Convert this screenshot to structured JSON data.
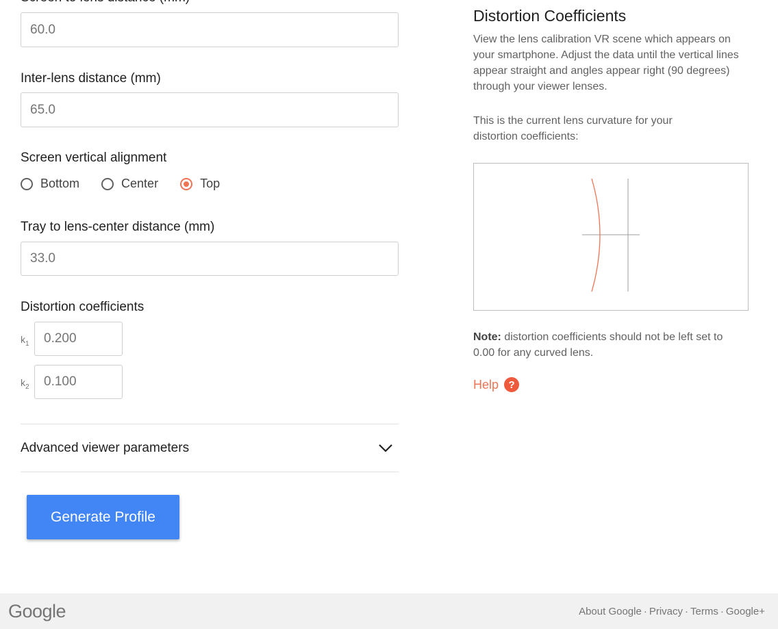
{
  "form": {
    "screen_to_lens": {
      "label": "Screen to lens distance (mm)",
      "value": "60.0"
    },
    "inter_lens": {
      "label": "Inter-lens distance (mm)",
      "value": "65.0"
    },
    "vertical_alignment": {
      "label": "Screen vertical alignment",
      "options": [
        "Bottom",
        "Center",
        "Top"
      ],
      "selected": "Top"
    },
    "tray_to_lens": {
      "label": "Tray to lens-center distance (mm)",
      "value": "33.0"
    },
    "distortion": {
      "label": "Distortion coefficients",
      "k1_label": "k",
      "k1_sub": "1",
      "k1_value": "0.200",
      "k2_label": "k",
      "k2_sub": "2",
      "k2_value": "0.100"
    },
    "advanced_label": "Advanced viewer parameters",
    "generate_label": "Generate Profile"
  },
  "info": {
    "title": "Distortion Coefficients",
    "description": "View the lens calibration VR scene which appears on your smartphone. Adjust the data until the vertical lines appear straight and angles appear right (90 degrees) through your viewer lenses.",
    "curvature_text": "This is the current lens curvature for your distortion coefficients:",
    "note_bold": "Note:",
    "note_text": " distortion coefficients should not be left set to 0.00 for any curved lens.",
    "help_label": "Help",
    "help_icon": "?"
  },
  "footer": {
    "logo": "Google",
    "links": [
      "About Google",
      "Privacy",
      "Terms",
      "Google+"
    ],
    "separator": "·"
  },
  "colors": {
    "accent": "#ee7454",
    "button": "#4285f4",
    "curve": "#ee7454"
  }
}
